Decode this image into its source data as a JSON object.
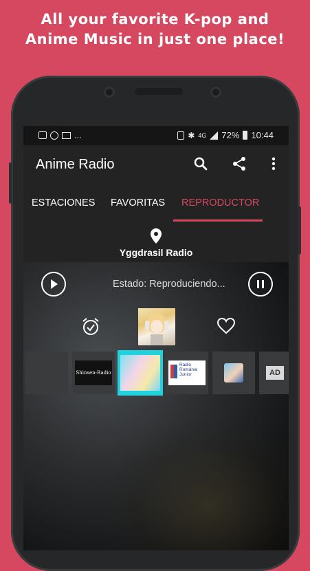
{
  "promo": {
    "line1": "All your favorite K-pop and",
    "line2": "Anime Music in just one place!"
  },
  "statusbar": {
    "left_text": "...",
    "right_signal": "4G",
    "battery": "72%",
    "time": "10:44"
  },
  "appbar": {
    "title": "Anime Radio",
    "icons": [
      "search-icon",
      "share-icon",
      "more-vert-icon"
    ]
  },
  "tabs": [
    {
      "label": "ESTACIONES",
      "active": false
    },
    {
      "label": "FAVORITAS",
      "active": false
    },
    {
      "label": "REPRODUCTOR",
      "active": true
    }
  ],
  "station": {
    "name": "Yggdrasil Radio",
    "icon": "location-pin-icon"
  },
  "player": {
    "status": "Estado: Reproduciendo...",
    "thumbnails": [
      {
        "name": "station-thumb-1",
        "label": ""
      },
      {
        "name": "station-thumb-shinsen",
        "label": "Shinsen-Radio"
      },
      {
        "name": "station-thumb-3",
        "label": ""
      },
      {
        "name": "station-thumb-romania",
        "label": "Radio România Junior"
      },
      {
        "name": "station-thumb-5",
        "label": ""
      },
      {
        "name": "station-thumb-ad",
        "label": "AD"
      }
    ]
  },
  "colors": {
    "background": "#d6485f",
    "accent": "#d6485f",
    "bar": "#232323"
  }
}
